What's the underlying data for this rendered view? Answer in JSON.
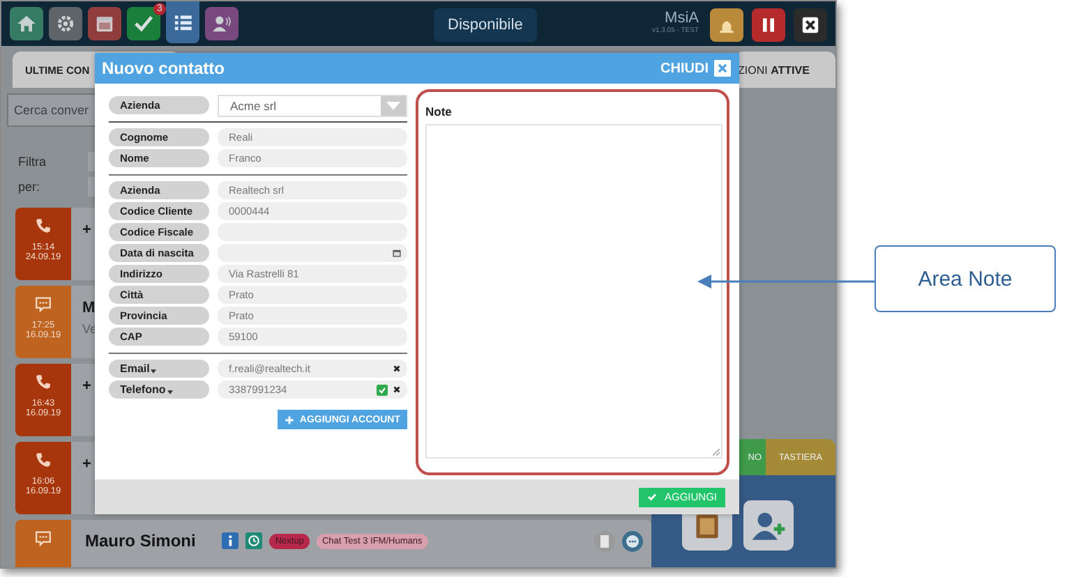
{
  "top_bar": {
    "apps": [
      {
        "kind": "home",
        "selected": false
      },
      {
        "kind": "settings",
        "selected": false
      },
      {
        "kind": "calendar",
        "selected": false
      },
      {
        "kind": "tasks",
        "selected": false,
        "badge": "3"
      },
      {
        "kind": "list",
        "selected": true
      },
      {
        "kind": "contacts",
        "selected": false
      }
    ],
    "status_button": "Disponibile",
    "user": "MsiA",
    "version": "v1.3.05 - TEST",
    "controls": [
      {
        "kind": "alarm"
      },
      {
        "kind": "pause"
      },
      {
        "kind": "close"
      }
    ]
  },
  "left_panel": {
    "tab": "ULTIME CON",
    "search": {
      "placeholder": "Cerca conver"
    },
    "filter_labels": [
      "Filtra",
      "per:"
    ],
    "conversations": [
      {
        "kind": "call",
        "time": "15:14",
        "date": "24.09.19",
        "title": "+"
      },
      {
        "kind": "chat",
        "time": "17:25",
        "date": "16.09.19",
        "title": "M",
        "preview": "Ve"
      },
      {
        "kind": "call",
        "time": "16:43",
        "date": "16.09.19",
        "title": "+"
      },
      {
        "kind": "call",
        "time": "16:06",
        "date": "16.09.19",
        "title": "+"
      }
    ],
    "last_conversation": {
      "kind": "chat",
      "title": "Mauro Simoni",
      "tags": [
        {
          "label": "Nextup",
          "color": "#b8284c"
        },
        {
          "label": "Chat Test 3 IFM/Humans",
          "color": "#d8a0ae"
        }
      ]
    }
  },
  "right_panel": {
    "tab": "ZIONI **ATTIVE**",
    "bottom_tabs": [
      {
        "label": "NO",
        "color": "#3f9a4a"
      },
      {
        "label": "TASTIERA",
        "color": "#a48a36"
      }
    ]
  },
  "modal": {
    "title": "Nuovo contatto",
    "close_label": "CHIUDI",
    "company_select": {
      "label": "Azienda",
      "value": "Acme srl"
    },
    "sections": [
      {
        "fields": [
          {
            "label": "Cognome",
            "value": "Reali",
            "kind": "text"
          },
          {
            "label": "Nome",
            "value": "Franco",
            "kind": "text"
          }
        ]
      },
      {
        "fields": [
          {
            "label": "Azienda",
            "value": "Realtech srl",
            "kind": "text"
          },
          {
            "label": "Codice Cliente",
            "value": "0000444",
            "kind": "text"
          },
          {
            "label": "Codice Fiscale",
            "kind": "text"
          },
          {
            "label": "Data di nascita",
            "kind": "date"
          },
          {
            "label": "Indirizzo",
            "value": "Via Rastrelli  81",
            "kind": "text"
          },
          {
            "label": "Città",
            "value": "Prato",
            "kind": "text"
          },
          {
            "label": "Provincia",
            "value": "Prato",
            "kind": "text"
          },
          {
            "label": "CAP",
            "value": "59100",
            "kind": "text"
          }
        ]
      }
    ],
    "accounts": [
      {
        "label": "Email",
        "value": "f.reali@realtech.it",
        "verified": false
      },
      {
        "label": "Telefono",
        "value": "3387991234",
        "verified": true
      }
    ],
    "add_account": "AGGIUNGI ACCOUNT",
    "notes_label": "Note",
    "submit": "AGGIUNGI"
  },
  "callout": {
    "text": "Area Note"
  }
}
